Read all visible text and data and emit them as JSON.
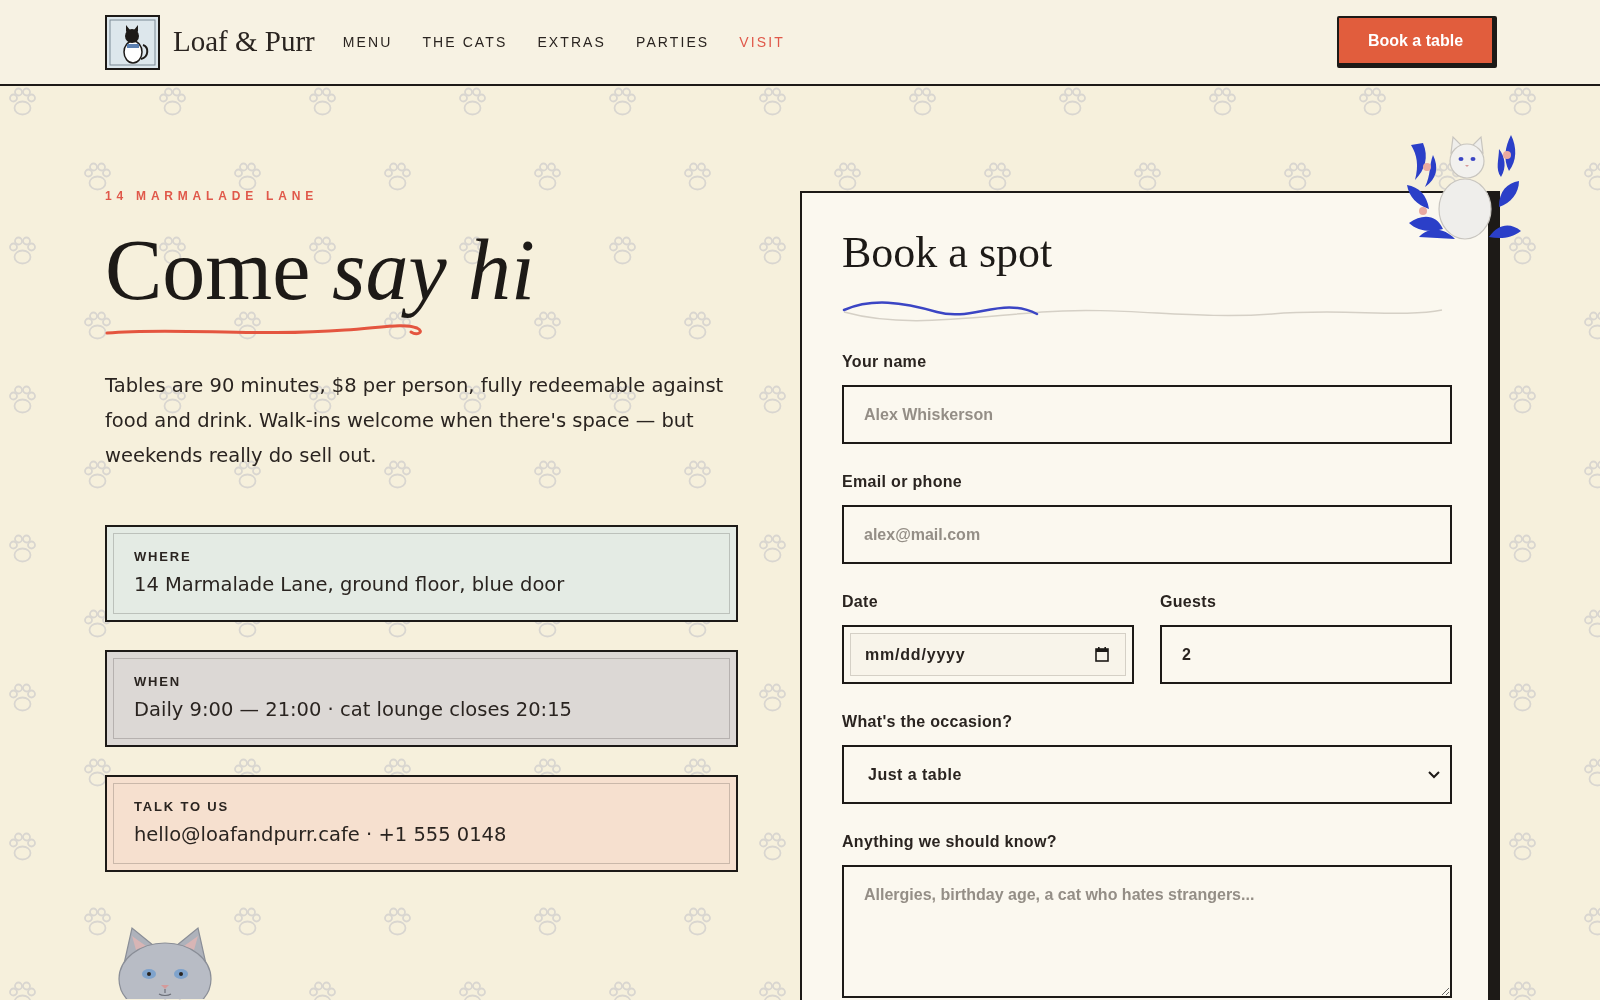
{
  "header": {
    "logo_text": "Loaf & Purr",
    "nav": [
      {
        "label": "MENU",
        "selected": false
      },
      {
        "label": "THE CATS",
        "selected": false
      },
      {
        "label": "EXTRAS",
        "selected": false
      },
      {
        "label": "PARTIES",
        "selected": false
      },
      {
        "label": "VISIT",
        "selected": true
      }
    ],
    "cta": "Book a table"
  },
  "intro": {
    "eyebrow": "14 MARMALADE LANE",
    "heading": "Come *say hi*",
    "body": "Tables are 90 minutes, $8 per person, fully redeemable against food and drink. Walk-ins welcome when there's space — but weekends really do sell out."
  },
  "info_cards": [
    {
      "label": "WHERE",
      "value": "14 Marmalade Lane, ground floor, blue door",
      "color": "#e4ebe4"
    },
    {
      "label": "WHEN",
      "value": "Daily 9:00 — 21:00 · cat lounge closes 20:15",
      "color": "#dcd8d5"
    },
    {
      "label": "TALK TO US",
      "value": "hello@loafandpurr.cafe · +1 555 0148",
      "color": "#f6e0cf"
    }
  ],
  "form": {
    "title": "Book a spot",
    "rows": [
      [
        {
          "kind": "text",
          "label": "Your name",
          "placeholder": "Alex Whiskerson"
        }
      ],
      [
        {
          "kind": "text",
          "label": "Email or phone",
          "placeholder": "alex@mail.com"
        }
      ],
      [
        {
          "kind": "date",
          "label": "Date",
          "placeholder": "mm/dd/yyyy"
        },
        {
          "kind": "number",
          "label": "Guests",
          "value": "2"
        }
      ],
      [
        {
          "kind": "select",
          "label": "What's the occasion?",
          "value": "Just a table"
        }
      ],
      [
        {
          "kind": "textarea",
          "label": "Anything we should know?",
          "placeholder": "Allergies, birthday age, a cat who hates strangers..."
        }
      ]
    ]
  }
}
